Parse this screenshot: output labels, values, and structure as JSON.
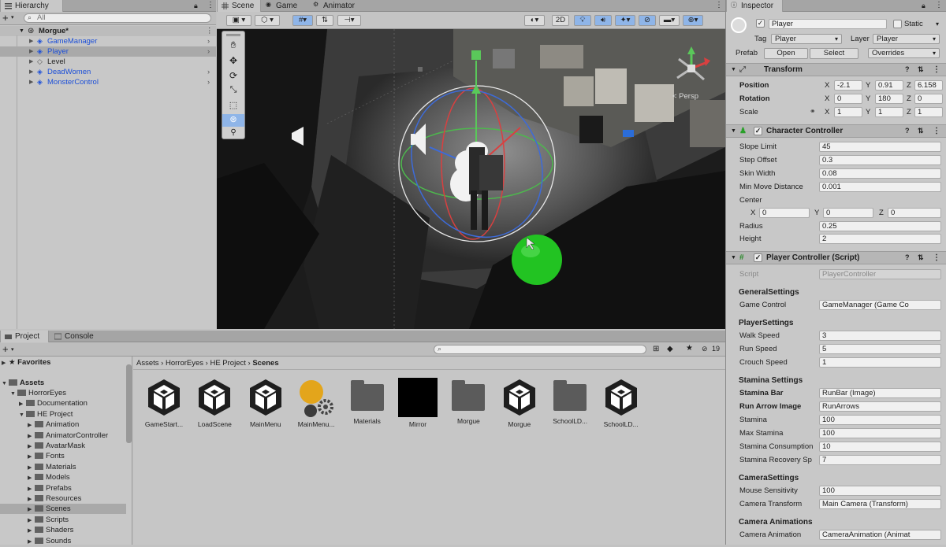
{
  "hierarchy": {
    "tab": "Hierarchy",
    "search_placeholder": "All",
    "scene": "Morgue*",
    "items": [
      {
        "label": "GameManager"
      },
      {
        "label": "Player"
      },
      {
        "label": "Level"
      },
      {
        "label": "DeadWomen"
      },
      {
        "label": "MonsterControl"
      }
    ]
  },
  "scene_tabs": {
    "scene": "Scene",
    "game": "Game",
    "animator": "Animator"
  },
  "scene_view": {
    "mode_2d": "2D",
    "persp_label": "< Persp"
  },
  "inspector": {
    "tab": "Inspector",
    "object_name": "Player",
    "static_label": "Static",
    "tag_label": "Tag",
    "tag_value": "Player",
    "layer_label": "Layer",
    "layer_value": "Player",
    "prefab_label": "Prefab",
    "open_label": "Open",
    "select_label": "Select",
    "overrides_label": "Overrides",
    "transform": {
      "title": "Transform",
      "position_label": "Position",
      "rotation_label": "Rotation",
      "scale_label": "Scale",
      "position": {
        "x": "-2.1",
        "y": "0.91",
        "z": "6.158"
      },
      "rotation": {
        "x": "0",
        "y": "180",
        "z": "0"
      },
      "scale": {
        "x": "1",
        "y": "1",
        "z": "1"
      }
    },
    "character_controller": {
      "title": "Character Controller",
      "slope_limit_label": "Slope Limit",
      "slope_limit": "45",
      "step_offset_label": "Step Offset",
      "step_offset": "0.3",
      "skin_width_label": "Skin Width",
      "skin_width": "0.08",
      "min_move_label": "Min Move Distance",
      "min_move": "0.001",
      "center_label": "Center",
      "center": {
        "x": "0",
        "y": "0",
        "z": "0"
      },
      "radius_label": "Radius",
      "radius": "0.25",
      "height_label": "Height",
      "height": "2"
    },
    "player_controller": {
      "title": "Player Controller (Script)",
      "script_label": "Script",
      "script_value": "PlayerController",
      "general_settings": "GeneralSettings",
      "game_control_label": "Game Control",
      "game_control_value": "GameManager (Game Co",
      "player_settings": "PlayerSettings",
      "walk_speed_label": "Walk Speed",
      "walk_speed": "3",
      "run_speed_label": "Run Speed",
      "run_speed": "5",
      "crouch_speed_label": "Crouch Speed",
      "crouch_speed": "1",
      "stamina_settings": "Stamina Settings",
      "stamina_bar_label": "Stamina Bar",
      "stamina_bar_value": "RunBar (Image)",
      "run_arrow_label": "Run Arrow Image",
      "run_arrow_value": "RunArrows",
      "stamina_label": "Stamina",
      "stamina": "100",
      "max_stamina_label": "Max Stamina",
      "max_stamina": "100",
      "stamina_consumption_label": "Stamina Consumption",
      "stamina_consumption": "10",
      "stamina_recovery_label": "Stamina Recovery Sp",
      "stamina_recovery": "7",
      "camera_settings": "CameraSettings",
      "mouse_sens_label": "Mouse Sensitivity",
      "mouse_sens": "100",
      "camera_transform_label": "Camera Transform",
      "camera_transform_value": "Main Camera (Transform)",
      "camera_animations": "Camera Animations",
      "camera_animation_label": "Camera Animation",
      "camera_animation_value": "CameraAnimation (Animat"
    }
  },
  "project": {
    "tab_project": "Project",
    "tab_console": "Console",
    "favorites": "Favorites",
    "assets": "Assets",
    "tree": [
      {
        "label": "HorrorEyes",
        "level": 1,
        "open": true
      },
      {
        "label": "Documentation",
        "level": 2,
        "open": false
      },
      {
        "label": "HE Project",
        "level": 2,
        "open": true
      },
      {
        "label": "Animation",
        "level": 3,
        "open": false
      },
      {
        "label": "AnimatorController",
        "level": 3,
        "open": false
      },
      {
        "label": "AvatarMask",
        "level": 3,
        "open": false
      },
      {
        "label": "Fonts",
        "level": 3,
        "open": false
      },
      {
        "label": "Materials",
        "level": 3,
        "open": false
      },
      {
        "label": "Models",
        "level": 3,
        "open": false
      },
      {
        "label": "Prefabs",
        "level": 3,
        "open": false
      },
      {
        "label": "Resources",
        "level": 3,
        "open": false
      },
      {
        "label": "Scenes",
        "level": 3,
        "open": false
      },
      {
        "label": "Scripts",
        "level": 3,
        "open": false
      },
      {
        "label": "Shaders",
        "level": 3,
        "open": false
      },
      {
        "label": "Sounds",
        "level": 3,
        "open": false
      }
    ],
    "breadcrumb": [
      "Assets",
      "HorrorEyes",
      "HE Project",
      "Scenes"
    ],
    "hidden_count": "19",
    "files": [
      {
        "name": "GameStart...",
        "kind": "unity"
      },
      {
        "name": "LoadScene",
        "kind": "unity"
      },
      {
        "name": "MainMenu",
        "kind": "unity"
      },
      {
        "name": "MainMenu...",
        "kind": "lighting"
      },
      {
        "name": "Materials",
        "kind": "folder"
      },
      {
        "name": "Mirror",
        "kind": "black"
      },
      {
        "name": "Morgue",
        "kind": "folder"
      },
      {
        "name": "Morgue",
        "kind": "unity"
      },
      {
        "name": "SchoolLD...",
        "kind": "folder"
      },
      {
        "name": "SchoolLD...",
        "kind": "unity"
      }
    ]
  }
}
